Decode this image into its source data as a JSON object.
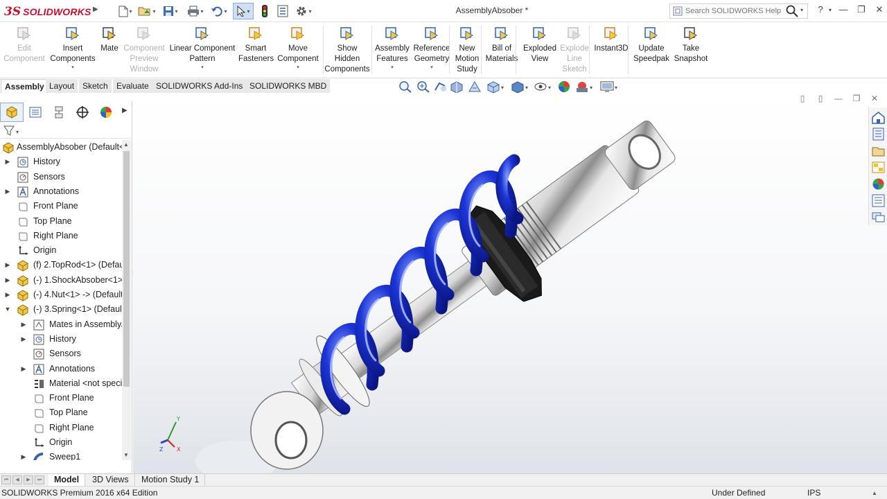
{
  "app": {
    "logo_ds": "3S",
    "logo_text": "SOLIDWORKS",
    "document_title": "AssemblyAbsober *"
  },
  "search": {
    "placeholder": "Search SOLIDWORKS Help"
  },
  "ribbon": [
    {
      "label": "Edit\nComponent",
      "icon": "edit-component-icon",
      "enabled": false
    },
    {
      "label": "Insert\nComponents",
      "icon": "insert-components-icon",
      "enabled": true,
      "dropdown": true
    },
    {
      "label": "Mate",
      "icon": "mate-icon",
      "enabled": true
    },
    {
      "label": "Component\nPreview\nWindow",
      "icon": "component-preview-icon",
      "enabled": false
    },
    {
      "label": "Linear Component\nPattern",
      "icon": "linear-pattern-icon",
      "enabled": true,
      "dropdown": true
    },
    {
      "label": "Smart\nFasteners",
      "icon": "smart-fasteners-icon",
      "enabled": true
    },
    {
      "label": "Move\nComponent",
      "icon": "move-component-icon",
      "enabled": true,
      "dropdown": true
    },
    {
      "label": "Show\nHidden\nComponents",
      "icon": "show-hidden-icon",
      "enabled": true
    },
    {
      "label": "Assembly\nFeatures",
      "icon": "assembly-features-icon",
      "enabled": true,
      "dropdown": true
    },
    {
      "label": "Reference\nGeometry",
      "icon": "reference-geometry-icon",
      "enabled": true,
      "dropdown": true
    },
    {
      "label": "New\nMotion\nStudy",
      "icon": "motion-study-icon",
      "enabled": true
    },
    {
      "label": "Bill of\nMaterials",
      "icon": "bill-of-materials-icon",
      "enabled": true
    },
    {
      "label": "Exploded\nView",
      "icon": "exploded-view-icon",
      "enabled": true
    },
    {
      "label": "Explode\nLine\nSketch",
      "icon": "explode-line-icon",
      "enabled": false
    },
    {
      "label": "Instant3D",
      "icon": "instant3d-icon",
      "enabled": true
    },
    {
      "label": "Update\nSpeedpak",
      "icon": "speedpak-icon",
      "enabled": true
    },
    {
      "label": "Take\nSnapshot",
      "icon": "camera-icon",
      "enabled": true
    }
  ],
  "command_tabs": [
    "Assembly",
    "Layout",
    "Sketch",
    "Evaluate",
    "SOLIDWORKS Add-Ins",
    "SOLIDWORKS MBD"
  ],
  "tree": {
    "root": "AssemblyAbsober  (Default<",
    "items": [
      {
        "label": "History",
        "icon": "history-icon",
        "indent": 0,
        "expander": "right"
      },
      {
        "label": "Sensors",
        "icon": "sensors-icon",
        "indent": 0,
        "expander": ""
      },
      {
        "label": "Annotations",
        "icon": "annotations-icon",
        "indent": 0,
        "expander": "right"
      },
      {
        "label": "Front Plane",
        "icon": "plane-icon",
        "indent": 0,
        "expander": ""
      },
      {
        "label": "Top Plane",
        "icon": "plane-icon",
        "indent": 0,
        "expander": ""
      },
      {
        "label": "Right Plane",
        "icon": "plane-icon",
        "indent": 0,
        "expander": ""
      },
      {
        "label": "Origin",
        "icon": "origin-icon",
        "indent": 0,
        "expander": ""
      },
      {
        "label": "(f) 2.TopRod<1> (Defau",
        "icon": "part-icon",
        "indent": 0,
        "expander": "right"
      },
      {
        "label": "(-) 1.ShockAbsober<1>",
        "icon": "part-icon",
        "indent": 0,
        "expander": "right"
      },
      {
        "label": "(-) 4.Nut<1> -> (Default",
        "icon": "part-icon",
        "indent": 0,
        "expander": "right"
      },
      {
        "label": "(-) 3.Spring<1> (Default",
        "icon": "part-icon",
        "indent": 0,
        "expander": "down"
      },
      {
        "label": "Mates in Assembly/",
        "icon": "mates-icon",
        "indent": 1,
        "expander": "right"
      },
      {
        "label": "History",
        "icon": "history-icon",
        "indent": 1,
        "expander": "right"
      },
      {
        "label": "Sensors",
        "icon": "sensors-icon",
        "indent": 1,
        "expander": ""
      },
      {
        "label": "Annotations",
        "icon": "annotations-icon",
        "indent": 1,
        "expander": "right"
      },
      {
        "label": "Material <not specif",
        "icon": "material-icon",
        "indent": 1,
        "expander": ""
      },
      {
        "label": "Front Plane",
        "icon": "plane-icon",
        "indent": 1,
        "expander": ""
      },
      {
        "label": "Top Plane",
        "icon": "plane-icon",
        "indent": 1,
        "expander": ""
      },
      {
        "label": "Right Plane",
        "icon": "plane-icon",
        "indent": 1,
        "expander": ""
      },
      {
        "label": "Origin",
        "icon": "origin-icon",
        "indent": 1,
        "expander": ""
      },
      {
        "label": "Sweep1",
        "icon": "sweep-icon",
        "indent": 1,
        "expander": "right"
      }
    ]
  },
  "bottom_tabs": [
    "Model",
    "3D Views",
    "Motion Study 1"
  ],
  "status": {
    "edition": "SOLIDWORKS Premium 2016 x64 Edition",
    "definition": "Under Defined",
    "units": "IPS"
  },
  "triad": {
    "x": "X",
    "y": "Y",
    "z": "Z"
  },
  "colors": {
    "spring_blue": "#1c35d6",
    "nut_black": "#1a1a1a",
    "brand_red": "#c8102e"
  }
}
